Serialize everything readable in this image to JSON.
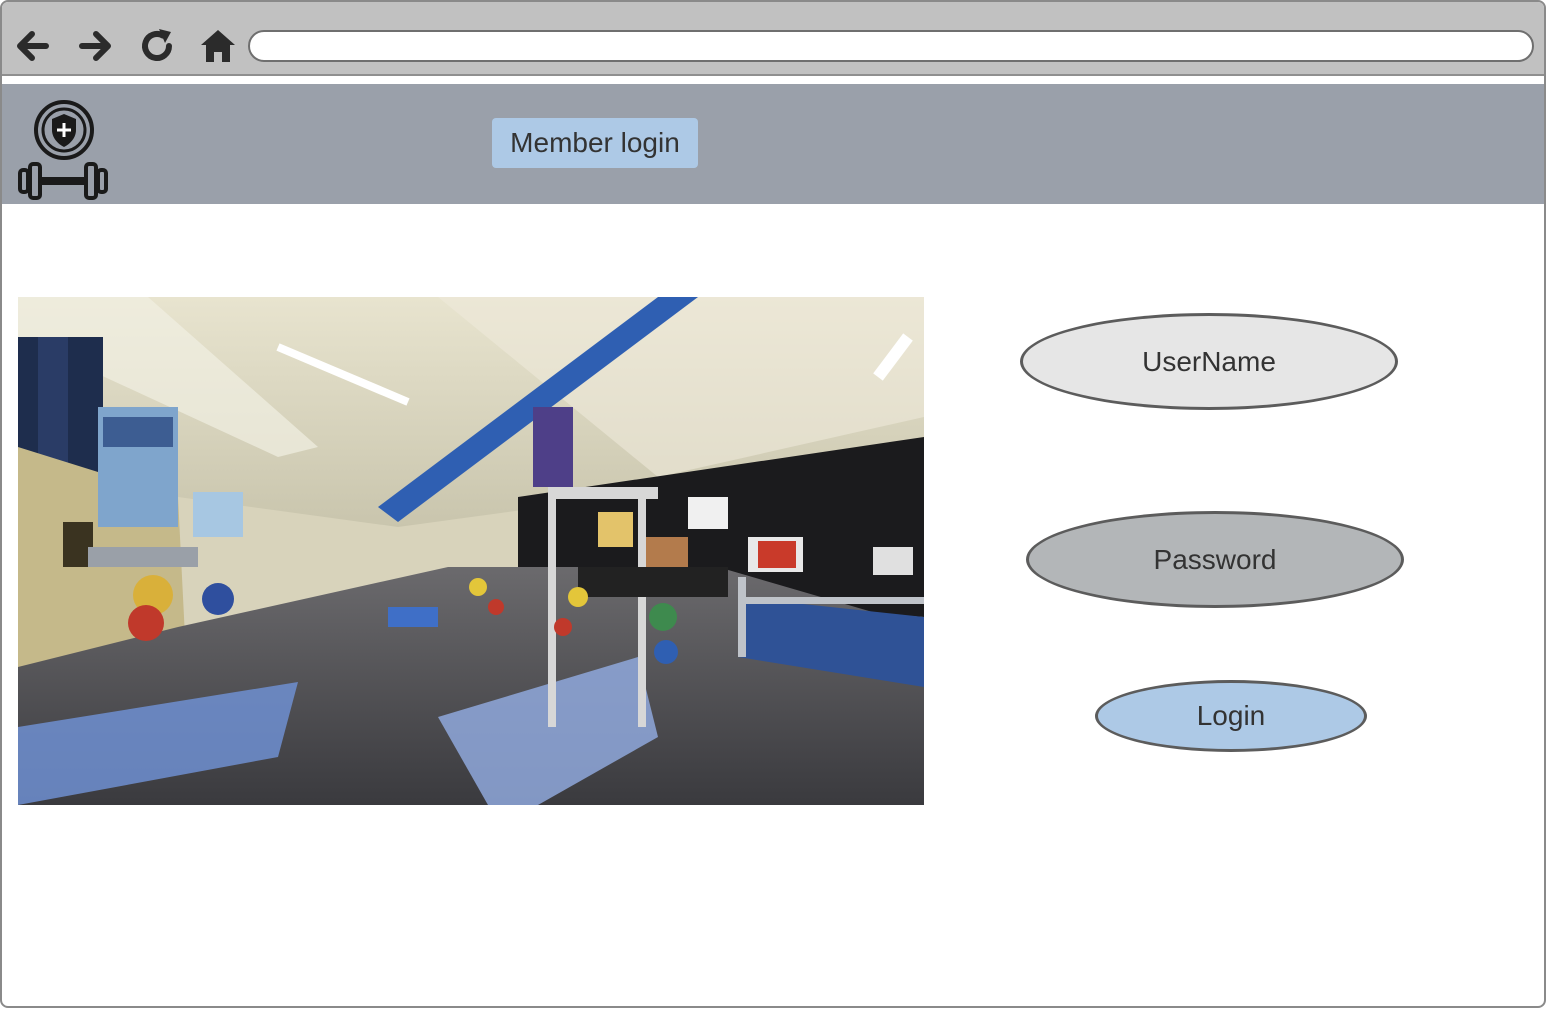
{
  "browser": {
    "back_icon": "arrow-left-icon",
    "forward_icon": "arrow-right-icon",
    "reload_icon": "reload-icon",
    "home_icon": "home-icon",
    "url": ""
  },
  "header": {
    "logo_icon": "shield-dumbbell-logo",
    "member_login_label": "Member login"
  },
  "main": {
    "photo": "gym-interior-photo",
    "username_label": "UserName",
    "password_label": "Password",
    "login_label": "Login"
  },
  "colors": {
    "browser_bar": "#c1c1c1",
    "header": "#9aa0aa",
    "accent_button": "#adc9e6",
    "username_field": "#e6e6e6",
    "password_field": "#b3b6b8"
  }
}
